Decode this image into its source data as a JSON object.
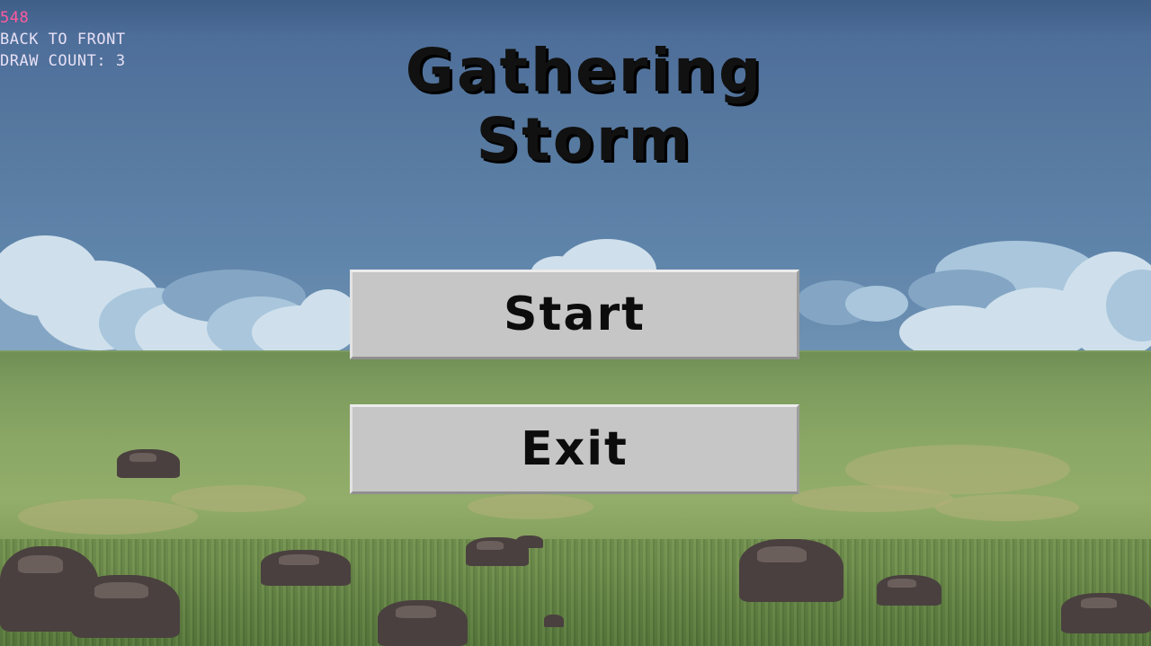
{
  "debug": {
    "fps": "548",
    "sort_mode": "BACK TO FRONT",
    "draw_count": "DRAW COUNT: 3"
  },
  "title": "Gathering Storm",
  "menu": {
    "start_label": "Start",
    "exit_label": "Exit"
  },
  "colors": {
    "sky": "#56789f",
    "ground": "#8aa765",
    "button": "#c6c6c6",
    "fps_text": "#ff5aa0",
    "debug_text": "#e7e0f5"
  }
}
